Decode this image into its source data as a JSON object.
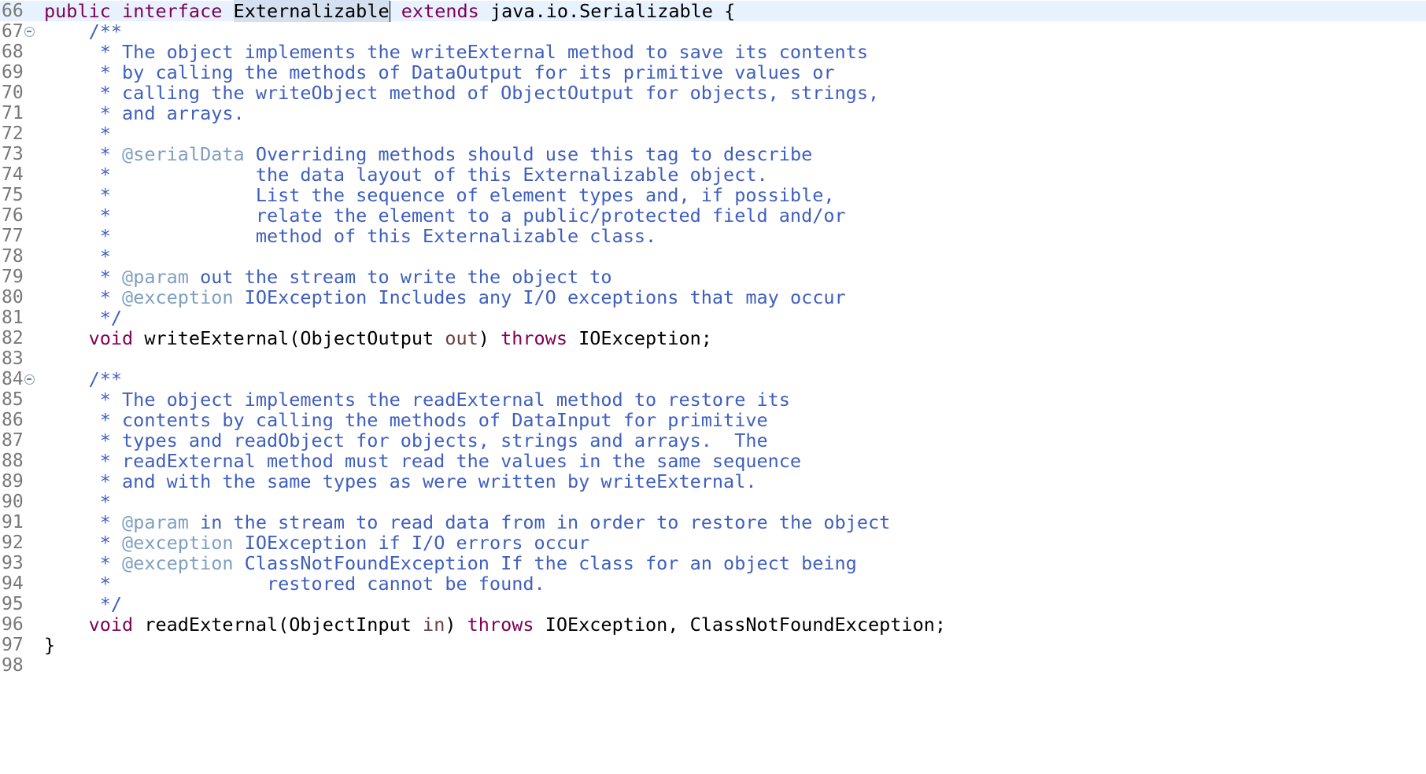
{
  "colors": {
    "keyword": "#7f0055",
    "javadoc": "#3f5fbf",
    "javadoc_tag": "#7f9fbf",
    "parameter": "#6a3e3e",
    "line_number": "#787878",
    "current_line": "#e8f2fe",
    "selection": "#d4dff0"
  },
  "editor": {
    "fold_icons": [
      "collapse-icon"
    ],
    "lines": [
      {
        "num": "66",
        "current": true,
        "segments": [
          {
            "t": "public",
            "c": "kw"
          },
          {
            "t": " ",
            "c": "plain"
          },
          {
            "t": "interface",
            "c": "kw"
          },
          {
            "t": " ",
            "c": "plain"
          },
          {
            "t": "Externalizable",
            "c": "plain",
            "hl": true,
            "caret": true
          },
          {
            "t": " ",
            "c": "plain"
          },
          {
            "t": "extends",
            "c": "kw"
          },
          {
            "t": " java.io.Serializable {",
            "c": "plain"
          }
        ]
      },
      {
        "num": "67",
        "fold": true,
        "segments": [
          {
            "t": "    /**",
            "c": "doc"
          }
        ]
      },
      {
        "num": "68",
        "segments": [
          {
            "t": "     * The object implements the writeExternal method to save its contents",
            "c": "doc"
          }
        ]
      },
      {
        "num": "69",
        "segments": [
          {
            "t": "     * by calling the methods of DataOutput for its primitive values or",
            "c": "doc"
          }
        ]
      },
      {
        "num": "70",
        "segments": [
          {
            "t": "     * calling the writeObject method of ObjectOutput for objects, strings,",
            "c": "doc"
          }
        ]
      },
      {
        "num": "71",
        "segments": [
          {
            "t": "     * and arrays.",
            "c": "doc"
          }
        ]
      },
      {
        "num": "72",
        "segments": [
          {
            "t": "     *",
            "c": "doc"
          }
        ]
      },
      {
        "num": "73",
        "segments": [
          {
            "t": "     * ",
            "c": "doc"
          },
          {
            "t": "@serialData",
            "c": "tag"
          },
          {
            "t": " Overriding methods should use this tag to describe",
            "c": "doc"
          }
        ]
      },
      {
        "num": "74",
        "segments": [
          {
            "t": "     *             the data layout of this Externalizable object.",
            "c": "doc"
          }
        ]
      },
      {
        "num": "75",
        "segments": [
          {
            "t": "     *             List the sequence of element types and, if possible,",
            "c": "doc"
          }
        ]
      },
      {
        "num": "76",
        "segments": [
          {
            "t": "     *             relate the element to a public/protected field and/or",
            "c": "doc"
          }
        ]
      },
      {
        "num": "77",
        "segments": [
          {
            "t": "     *             method of this Externalizable class.",
            "c": "doc"
          }
        ]
      },
      {
        "num": "78",
        "segments": [
          {
            "t": "     *",
            "c": "doc"
          }
        ]
      },
      {
        "num": "79",
        "segments": [
          {
            "t": "     * ",
            "c": "doc"
          },
          {
            "t": "@param",
            "c": "tag"
          },
          {
            "t": " out the stream to write the object to",
            "c": "doc"
          }
        ]
      },
      {
        "num": "80",
        "segments": [
          {
            "t": "     * ",
            "c": "doc"
          },
          {
            "t": "@exception",
            "c": "tag"
          },
          {
            "t": " IOException Includes any I/O exceptions that may occur",
            "c": "doc"
          }
        ]
      },
      {
        "num": "81",
        "segments": [
          {
            "t": "     */",
            "c": "doc"
          }
        ]
      },
      {
        "num": "82",
        "segments": [
          {
            "t": "    ",
            "c": "plain"
          },
          {
            "t": "void",
            "c": "kw"
          },
          {
            "t": " writeExternal(ObjectOutput ",
            "c": "plain"
          },
          {
            "t": "out",
            "c": "param"
          },
          {
            "t": ") ",
            "c": "plain"
          },
          {
            "t": "throws",
            "c": "kw"
          },
          {
            "t": " IOException;",
            "c": "plain"
          }
        ]
      },
      {
        "num": "83",
        "segments": []
      },
      {
        "num": "84",
        "fold": true,
        "segments": [
          {
            "t": "    /**",
            "c": "doc"
          }
        ]
      },
      {
        "num": "85",
        "segments": [
          {
            "t": "     * The object implements the readExternal method to restore its",
            "c": "doc"
          }
        ]
      },
      {
        "num": "86",
        "segments": [
          {
            "t": "     * contents by calling the methods of DataInput for primitive",
            "c": "doc"
          }
        ]
      },
      {
        "num": "87",
        "segments": [
          {
            "t": "     * types and readObject for objects, strings and arrays.  The",
            "c": "doc"
          }
        ]
      },
      {
        "num": "88",
        "segments": [
          {
            "t": "     * readExternal method must read the values in the same sequence",
            "c": "doc"
          }
        ]
      },
      {
        "num": "89",
        "segments": [
          {
            "t": "     * and with the same types as were written by writeExternal.",
            "c": "doc"
          }
        ]
      },
      {
        "num": "90",
        "segments": [
          {
            "t": "     *",
            "c": "doc"
          }
        ]
      },
      {
        "num": "91",
        "segments": [
          {
            "t": "     * ",
            "c": "doc"
          },
          {
            "t": "@param",
            "c": "tag"
          },
          {
            "t": " in the stream to read data from in order to restore the object",
            "c": "doc"
          }
        ]
      },
      {
        "num": "92",
        "segments": [
          {
            "t": "     * ",
            "c": "doc"
          },
          {
            "t": "@exception",
            "c": "tag"
          },
          {
            "t": " IOException if I/O errors occur",
            "c": "doc"
          }
        ]
      },
      {
        "num": "93",
        "segments": [
          {
            "t": "     * ",
            "c": "doc"
          },
          {
            "t": "@exception",
            "c": "tag"
          },
          {
            "t": " ClassNotFoundException If the class for an object being",
            "c": "doc"
          }
        ]
      },
      {
        "num": "94",
        "segments": [
          {
            "t": "     *              restored cannot be found.",
            "c": "doc"
          }
        ]
      },
      {
        "num": "95",
        "segments": [
          {
            "t": "     */",
            "c": "doc"
          }
        ]
      },
      {
        "num": "96",
        "segments": [
          {
            "t": "    ",
            "c": "plain"
          },
          {
            "t": "void",
            "c": "kw"
          },
          {
            "t": " readExternal(ObjectInput ",
            "c": "plain"
          },
          {
            "t": "in",
            "c": "param"
          },
          {
            "t": ") ",
            "c": "plain"
          },
          {
            "t": "throws",
            "c": "kw"
          },
          {
            "t": " IOException, ClassNotFoundException;",
            "c": "plain"
          }
        ]
      },
      {
        "num": "97",
        "segments": [
          {
            "t": "}",
            "c": "plain"
          }
        ]
      },
      {
        "num": "98",
        "segments": []
      }
    ]
  }
}
